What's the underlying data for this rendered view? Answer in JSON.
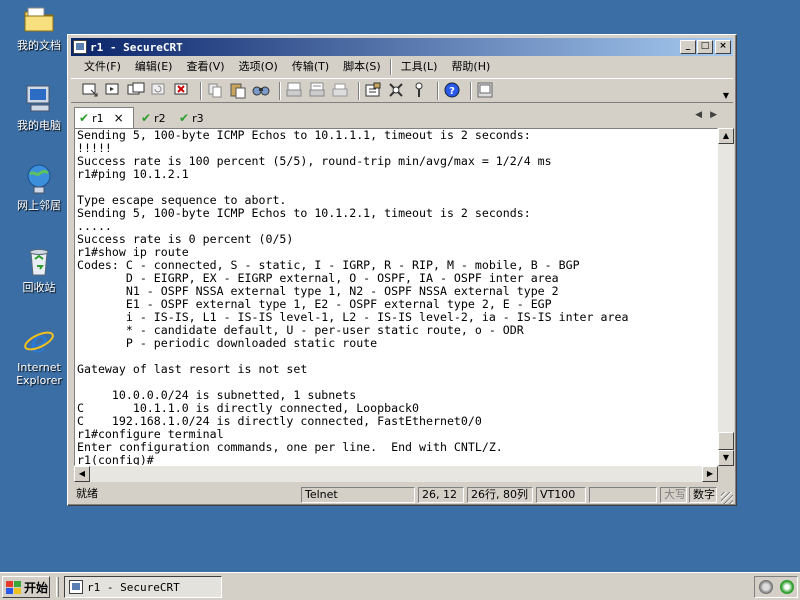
{
  "desktop": {
    "icons": [
      {
        "label": "我的文档"
      },
      {
        "label": "我的电脑"
      },
      {
        "label": "网上邻居"
      },
      {
        "label": "回收站"
      },
      {
        "label": "Internet Explorer"
      }
    ]
  },
  "window": {
    "title": "r1 - SecureCRT",
    "menu": [
      "文件(F)",
      "编辑(E)",
      "查看(V)",
      "选项(O)",
      "传输(T)",
      "脚本(S)",
      "工具(L)",
      "帮助(H)"
    ],
    "tabs": [
      {
        "label": "r1",
        "active": true
      },
      {
        "label": "r2",
        "active": false
      },
      {
        "label": "r3",
        "active": false
      }
    ],
    "terminal_lines": [
      "Sending 5, 100-byte ICMP Echos to 10.1.1.1, timeout is 2 seconds:",
      "!!!!!",
      "Success rate is 100 percent (5/5), round-trip min/avg/max = 1/2/4 ms",
      "r1#ping 10.1.2.1",
      "",
      "Type escape sequence to abort.",
      "Sending 5, 100-byte ICMP Echos to 10.1.2.1, timeout is 2 seconds:",
      ".....",
      "Success rate is 0 percent (0/5)",
      "r1#show ip route",
      "Codes: C - connected, S - static, I - IGRP, R - RIP, M - mobile, B - BGP",
      "       D - EIGRP, EX - EIGRP external, O - OSPF, IA - OSPF inter area",
      "       N1 - OSPF NSSA external type 1, N2 - OSPF NSSA external type 2",
      "       E1 - OSPF external type 1, E2 - OSPF external type 2, E - EGP",
      "       i - IS-IS, L1 - IS-IS level-1, L2 - IS-IS level-2, ia - IS-IS inter area",
      "       * - candidate default, U - per-user static route, o - ODR",
      "       P - periodic downloaded static route",
      "",
      "Gateway of last resort is not set",
      "",
      "     10.0.0.0/24 is subnetted, 1 subnets",
      "C       10.1.1.0 is directly connected, Loopback0",
      "C    192.168.1.0/24 is directly connected, FastEthernet0/0",
      "r1#configure terminal",
      "Enter configuration commands, one per line.  End with CNTL/Z.",
      "r1(config)#"
    ],
    "status": {
      "ready": "就绪",
      "protocol": "Telnet",
      "cursor": "26, 12",
      "size": "26行, 80列",
      "emulation": "VT100",
      "caps": "大写",
      "num": "数字"
    }
  },
  "taskbar": {
    "start_label": "开始",
    "task_label": "r1 - SecureCRT"
  }
}
